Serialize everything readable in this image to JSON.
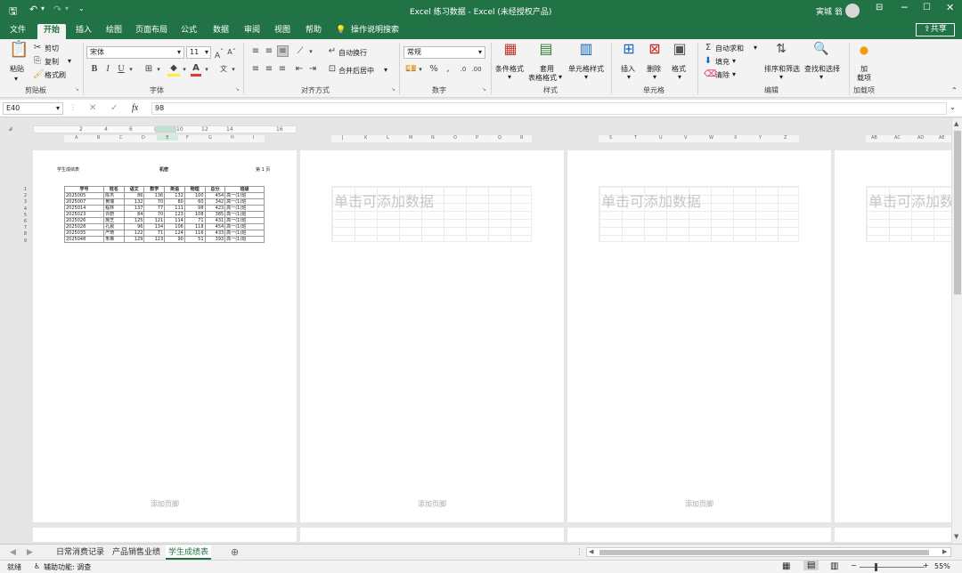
{
  "window": {
    "title": "Excel 练习数据  -  Excel (未经授权产品)",
    "user": "寅城 翁",
    "share_label": "共享",
    "accent": "#217346"
  },
  "qat": {
    "save_icon": "save-icon",
    "undo_icon": "undo-icon",
    "redo_icon": "redo-icon"
  },
  "tabs": [
    "文件",
    "开始",
    "插入",
    "绘图",
    "页面布局",
    "公式",
    "数据",
    "审阅",
    "视图",
    "帮助"
  ],
  "tell_me": "操作说明搜索",
  "ribbon": {
    "clipboard": {
      "paste": "粘贴",
      "cut": "剪切",
      "copy": "复制",
      "format_painter": "格式刷",
      "label": "剪贴板"
    },
    "font": {
      "name": "宋体",
      "size": "11",
      "bold": "B",
      "italic": "I",
      "underline": "U",
      "label": "字体"
    },
    "alignment": {
      "wrap": "自动换行",
      "merge": "合并后居中",
      "label": "对齐方式"
    },
    "number": {
      "format": "常规",
      "label": "数字"
    },
    "styles": {
      "conditional": "条件格式",
      "table": "套用\n表格格式",
      "table1": "套用",
      "table2": "表格格式",
      "cell": "单元格样式",
      "label": "样式"
    },
    "cells": {
      "insert": "插入",
      "delete": "删除",
      "format": "格式",
      "label": "单元格"
    },
    "editing": {
      "autosum": "自动求和",
      "fill": "填充",
      "clear": "清除",
      "sort": "排序和筛选",
      "find": "查找和选择",
      "label": "编辑"
    },
    "addins": {
      "addin1": "加",
      "addin2": "载项",
      "label": "加载项"
    }
  },
  "formula_bar": {
    "name_box": "E40",
    "fx": "fx",
    "value": "98"
  },
  "pages": {
    "header_left": "学生成绩表",
    "header_center": "机密",
    "header_right": "第 1 页",
    "placeholder": "单击可添加数据",
    "footer": "添加页脚"
  },
  "table": {
    "headers": [
      "学号",
      "姓名",
      "语文",
      "数学",
      "英语",
      "物理",
      "总分",
      "班级"
    ],
    "rows": [
      [
        "2025005",
        "陈杰",
        "86",
        "136",
        "132",
        "100",
        "454",
        "高一(1)班"
      ],
      [
        "2025007",
        "黄瑞",
        "132",
        "70",
        "80",
        "60",
        "342",
        "高一(1)班"
      ],
      [
        "2025014",
        "程林",
        "137",
        "77",
        "111",
        "98",
        "423",
        "高一(1)班"
      ],
      [
        "2025023",
        "许蔚",
        "84",
        "70",
        "123",
        "108",
        "385",
        "高一(1)班"
      ],
      [
        "2025026",
        "施芝",
        "125",
        "121",
        "114",
        "71",
        "431",
        "高一(1)班"
      ],
      [
        "2025028",
        "孔晨",
        "96",
        "134",
        "106",
        "118",
        "454",
        "高一(1)班"
      ],
      [
        "2025035",
        "严琦",
        "122",
        "71",
        "124",
        "116",
        "433",
        "高一(1)班"
      ],
      [
        "2025048",
        "朱琳",
        "129",
        "123",
        "90",
        "51",
        "393",
        "高一(1)班"
      ]
    ],
    "row_numbers": [
      "1",
      "2",
      "3",
      "4",
      "5",
      "6",
      "7",
      "8",
      "9"
    ]
  },
  "ruler": {
    "top_numbers": [
      "2",
      "4",
      "6",
      "8",
      "10",
      "12",
      "14",
      "16"
    ],
    "col_letters_p1": [
      "A",
      "B",
      "C",
      "D",
      "E",
      "F",
      "G",
      "H",
      "I"
    ],
    "col_letters_p2": [
      "J",
      "K",
      "L",
      "M",
      "N",
      "O",
      "P",
      "Q",
      "R"
    ],
    "col_letters_p3": [
      "S",
      "T",
      "U",
      "V",
      "W",
      "X",
      "Y",
      "Z"
    ],
    "col_letters_p4": [
      "AB",
      "AC",
      "AD",
      "AE"
    ]
  },
  "sheets": [
    "日常消费记录",
    "产品销售业绩",
    "学生成绩表"
  ],
  "status": {
    "ready": "就绪",
    "accessibility": "辅助功能: 调查",
    "zoom": "55%"
  }
}
